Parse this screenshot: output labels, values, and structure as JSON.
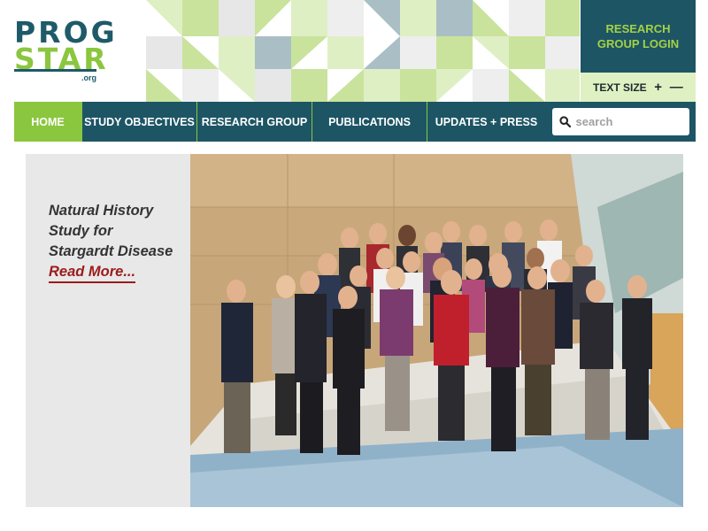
{
  "logo": {
    "line1": "PROG",
    "line2": "STAR",
    "suffix": ".org"
  },
  "header": {
    "login_label": "RESEARCH GROUP LOGIN",
    "text_size_label": "TEXT SIZE",
    "increase_label": "+",
    "decrease_label": "—"
  },
  "nav": {
    "items": [
      {
        "label": "HOME",
        "active": true
      },
      {
        "label": "STUDY OBJECTIVES"
      },
      {
        "label": "RESEARCH GROUP"
      },
      {
        "label": "PUBLICATIONS"
      },
      {
        "label": "UPDATES + PRESS"
      }
    ],
    "search_placeholder": "search"
  },
  "hero": {
    "title": "Natural History Study for Stargardt Disease",
    "link_label": "Read More..."
  },
  "colors": {
    "primary_teal": "#1d5565",
    "accent_green": "#8bc63f",
    "link_red": "#9b1b1b",
    "hero_bg": "#e8e8e8"
  }
}
